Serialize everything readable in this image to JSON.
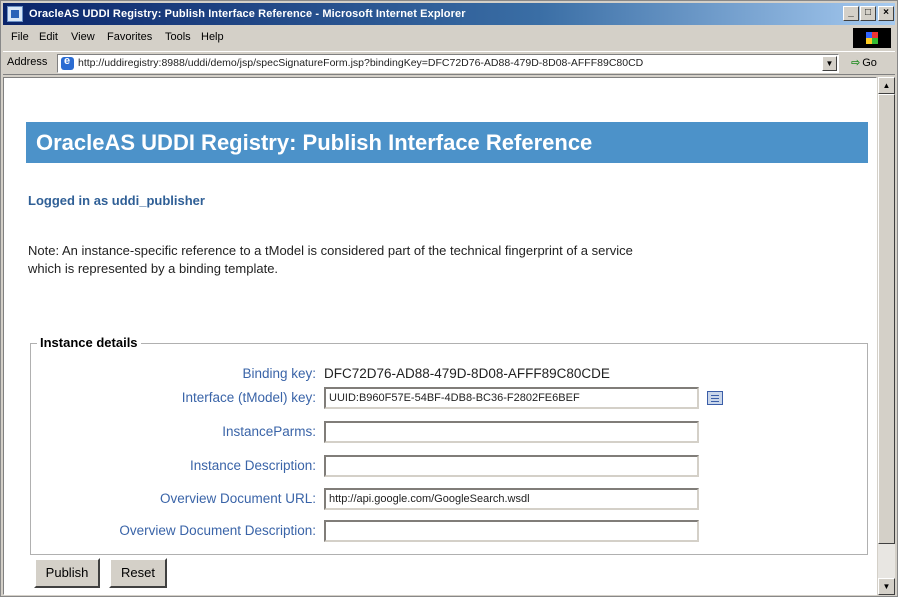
{
  "window": {
    "title": "OracleAS UDDI Registry: Publish Interface Reference - Microsoft Internet Explorer",
    "controls": {
      "minimize": "_",
      "maximize": "□",
      "close": "×"
    }
  },
  "menu": [
    "File",
    "Edit",
    "View",
    "Favorites",
    "Tools",
    "Help"
  ],
  "address": {
    "label": "Address",
    "url": "http://uddiregistry:8988/uddi/demo/jsp/specSignatureForm.jsp?bindingKey=DFC72D76-AD88-479D-8D08-AFFF89C80CD",
    "go_label": "Go"
  },
  "page": {
    "title": "OracleAS UDDI Registry: Publish Interface Reference",
    "logged_in": "Logged in as uddi_publisher",
    "note": "Note: An instance-specific reference to a tModel is considered part of the technical fingerprint of a service which is represented by a binding template."
  },
  "instance_details": {
    "legend": "Instance details",
    "binding_key_label": "Binding key:",
    "binding_key_value": "DFC72D76-AD88-479D-8D08-AFFF89C80CDE",
    "interface_label": "Interface (tModel) key:",
    "interface_value": "UUID:B960F57E-54BF-4DB8-BC36-F2802FE6BEF",
    "instance_parms_label": "InstanceParms:",
    "instance_parms_value": "",
    "instance_description_label": "Instance Description:",
    "instance_description_value": "",
    "overview_url_label": "Overview Document URL:",
    "overview_url_value": "http://api.google.com/GoogleSearch.wsdl",
    "overview_description_label": "Overview Document Description:",
    "overview_description_value": ""
  },
  "buttons": {
    "publish": "Publish",
    "reset": "Reset"
  },
  "colors": {
    "header_bg": "#4c92c9",
    "label_blue": "#3a64a8",
    "logged_in": "#2f5f96"
  }
}
